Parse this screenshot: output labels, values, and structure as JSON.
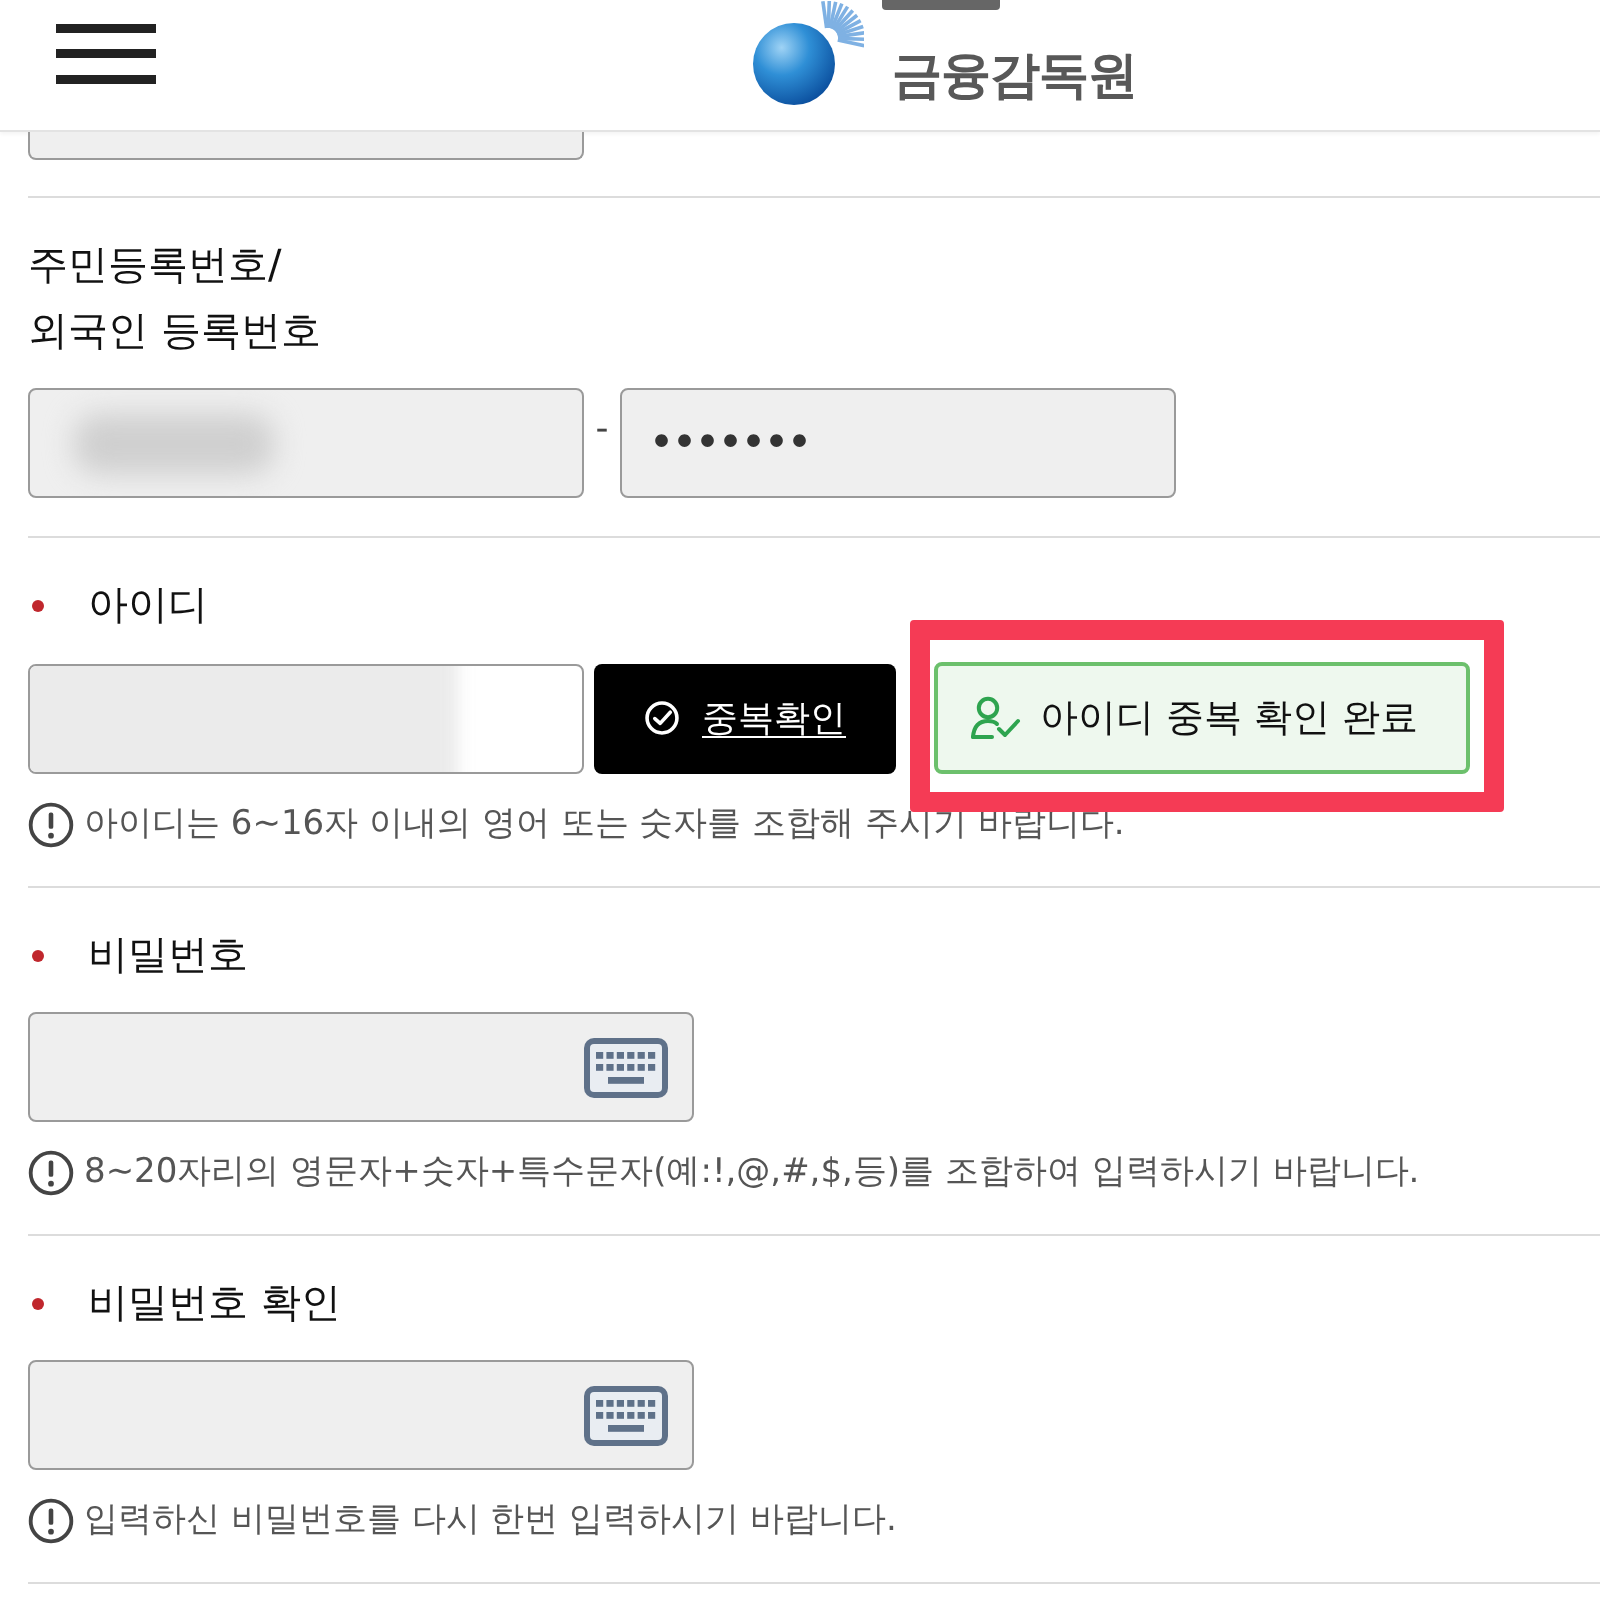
{
  "header": {
    "logo_text": "금융감독원"
  },
  "sections": [
    {
      "kind": "cut",
      "fields": [
        {
          "kind": "partial"
        }
      ]
    },
    {
      "kind": "field",
      "label": "주민등록번호/\n외국인 등록번호",
      "required": false,
      "separator": "-",
      "fields": [
        {
          "kind": "blurred"
        },
        {
          "kind": "masked",
          "value": "•••••••"
        }
      ]
    },
    {
      "kind": "field",
      "label": "아이디",
      "required": true,
      "fields": [
        {
          "kind": "blurred_white"
        }
      ],
      "check_button": "중복확인",
      "status_button": {
        "label": "아이디 중복 확인 완료",
        "highlighted": true
      },
      "hint": "아이디는 6~16자 이내의 영어 또는 숫자를 조합해 주시기 바랍니다."
    },
    {
      "kind": "field",
      "label": "비밀번호",
      "required": true,
      "fields": [
        {
          "kind": "keypad"
        }
      ],
      "hint": "8~20자리의 영문자+숫자+특수문자(예:!,@,#,$,등)를 조합하여 입력하시기 바랍니다."
    },
    {
      "kind": "field",
      "label": "비밀번호 확인",
      "required": true,
      "fields": [
        {
          "kind": "keypad"
        }
      ],
      "hint": "입력하신 비밀번호를 다시 한번 입력하시기 바랍니다."
    }
  ]
}
